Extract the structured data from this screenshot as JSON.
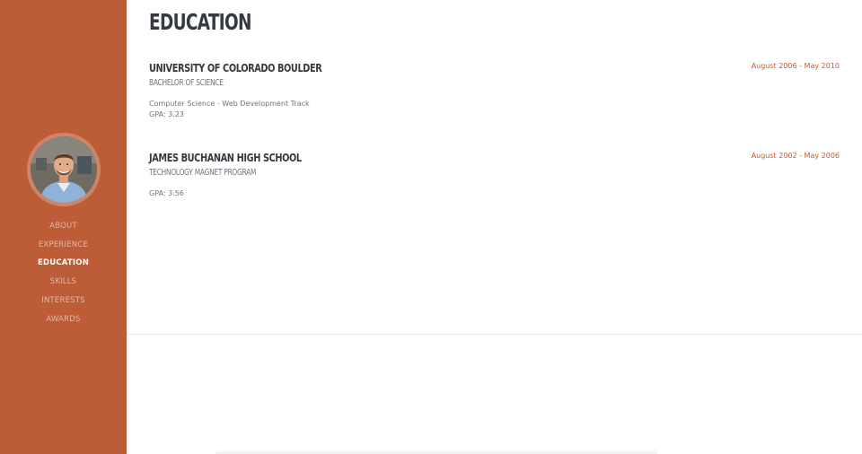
{
  "colors": {
    "sidebar": "#bd5d38",
    "accent": "#bd5d38",
    "heading": "#343a40",
    "muted": "#6c757d"
  },
  "profile": {
    "avatar_icon": "profile-photo"
  },
  "nav": {
    "items": [
      {
        "label": "About",
        "active": false
      },
      {
        "label": "Experience",
        "active": false
      },
      {
        "label": "Education",
        "active": true
      },
      {
        "label": "Skills",
        "active": false
      },
      {
        "label": "Interests",
        "active": false
      },
      {
        "label": "Awards",
        "active": false
      }
    ]
  },
  "section": {
    "title": "Education",
    "entries": [
      {
        "school": "University of Colorado Boulder",
        "degree": "Bachelor of Science",
        "detail": "Computer Science - Web Development Track",
        "gpa": "GPA: 3.23",
        "dates": "August 2006 - May 2010"
      },
      {
        "school": "James Buchanan High School",
        "degree": "Technology Magnet Program",
        "gpa": "GPA: 3.56",
        "dates": "August 2002 - May 2006"
      }
    ]
  }
}
